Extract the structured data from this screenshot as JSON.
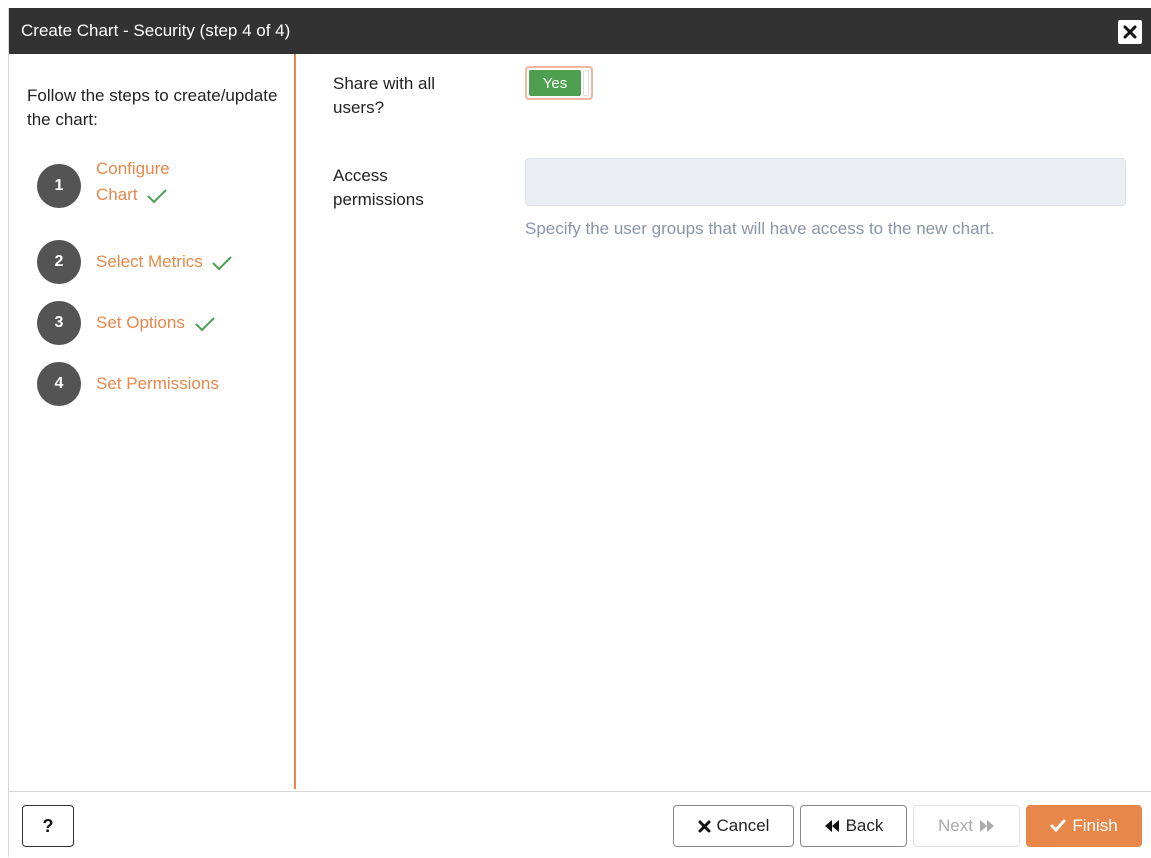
{
  "dialog": {
    "title": "Create Chart - Security (step 4 of 4)"
  },
  "sidebar": {
    "intro": "Follow the steps to create/update the chart:",
    "steps": [
      {
        "number": "1",
        "label_line1": "Configure",
        "label_line2": "Chart",
        "completed": true
      },
      {
        "number": "2",
        "label": "Select Metrics",
        "completed": true
      },
      {
        "number": "3",
        "label": "Set Options",
        "completed": true
      },
      {
        "number": "4",
        "label": "Set Permissions",
        "completed": false
      }
    ]
  },
  "form": {
    "share_label_line1": "Share with all",
    "share_label_line2": "users?",
    "share_toggle_value": "Yes",
    "access_label_line1": "Access",
    "access_label_line2": "permissions",
    "access_value": "",
    "access_help": "Specify the user groups that will have access to the new chart."
  },
  "footer": {
    "help_label": "?",
    "cancel_label": "Cancel",
    "back_label": "Back",
    "next_label": "Next",
    "finish_label": "Finish"
  },
  "icons": {
    "close": "close-icon",
    "check": "check-icon",
    "cancel": "x-icon",
    "back": "double-chevron-left-icon",
    "next": "double-chevron-right-icon",
    "finish": "check-icon"
  },
  "colors": {
    "accent": "#e8874a",
    "titlebar": "#323232",
    "toggle_on": "#4e9f4f",
    "check": "#4e9f4f",
    "step_circle": "#545454",
    "help_text": "#8a94a6"
  }
}
